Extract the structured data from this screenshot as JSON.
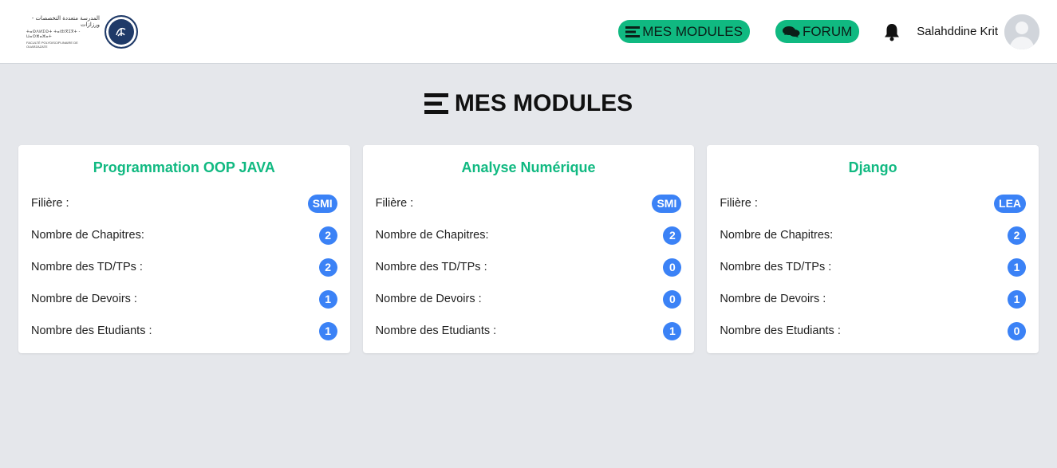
{
  "header": {
    "logo": {
      "arabic_text": "المدرسة متعددة التخصصات - ورزازات",
      "tifinagh_text": "ⵜⴰⵙⴷⵍⵉⵙⵜ ⵜⴰⵏⵓⵏⴳⵉⴳⵜ - ⵡⴰⵔⵣⴰⵣⴰⵜ",
      "french_text": "FACULTÉ POLYDISCIPLINAIRE DE OUARZAZATE"
    },
    "nav": {
      "modules_label": "MES MODULES",
      "forum_label": "FORUM"
    },
    "user": {
      "name": "Salahddine Krit"
    }
  },
  "page": {
    "title": "MES MODULES"
  },
  "row_labels": {
    "filiere": "Filière :",
    "chapitres": "Nombre de Chapitres:",
    "tds": "Nombre des TD/TPs :",
    "devoirs": "Nombre de Devoirs :",
    "etudiants": "Nombre des Etudiants :"
  },
  "modules": [
    {
      "title": "Programmation OOP JAVA",
      "filiere": "SMI",
      "chapitres": "2",
      "tds": "2",
      "devoirs": "1",
      "etudiants": "1"
    },
    {
      "title": "Analyse Numérique",
      "filiere": "SMI",
      "chapitres": "2",
      "tds": "0",
      "devoirs": "0",
      "etudiants": "1"
    },
    {
      "title": "Django",
      "filiere": "LEA",
      "chapitres": "2",
      "tds": "1",
      "devoirs": "1",
      "etudiants": "0"
    }
  ],
  "colors": {
    "accent_green": "#10b981",
    "badge_blue": "#3b82f6",
    "background": "#e5e7eb"
  }
}
